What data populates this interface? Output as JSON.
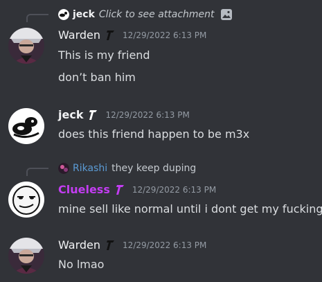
{
  "messages": [
    {
      "reply": {
        "username": "jeck",
        "text": "Click to see attachment",
        "icon": "image-icon"
      },
      "username": "Warden",
      "timestamp": "12/29/2022 6:13 PM",
      "lines": [
        "This is my friend",
        "don’t ban him"
      ]
    },
    {
      "username": "jeck",
      "timestamp": "12/29/2022 6:13 PM",
      "lines": [
        "does this friend happen to be m3x"
      ]
    },
    {
      "reply": {
        "username": "Rikashi",
        "text": "they keep duping"
      },
      "username": "Clueless",
      "timestamp": "12/29/2022 6:13 PM",
      "lines": [
        "mine sell like normal until i dont get my fucking"
      ]
    },
    {
      "username": "Warden",
      "timestamp": "12/29/2022 6:13 PM",
      "lines": [
        "No lmao"
      ]
    }
  ],
  "colors": {
    "background": "#313338",
    "clueless_name": "#c33df2",
    "rikashi_name": "#5b9bd5",
    "timestamp": "#949ba4"
  }
}
